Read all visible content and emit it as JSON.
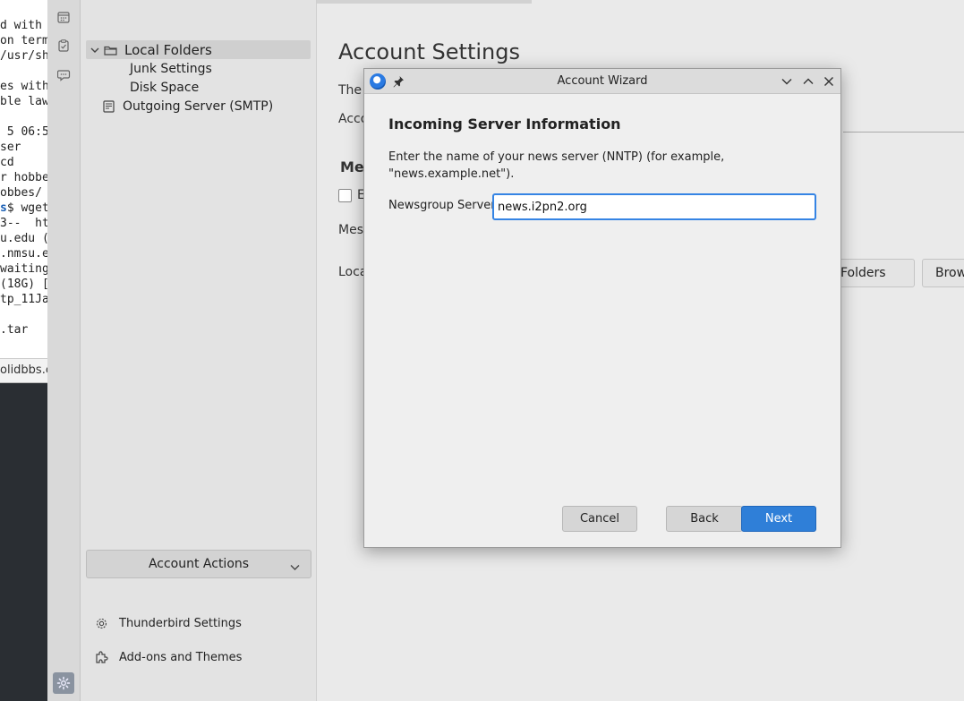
{
  "terminal": {
    "lines": [
      {
        "prefix": "",
        "text": "d with"
      },
      {
        "prefix": "",
        "text": "on term"
      },
      {
        "prefix": "",
        "text": "/usr/sh"
      },
      {
        "prefix": "",
        "text": ""
      },
      {
        "prefix": "",
        "text": "es with"
      },
      {
        "prefix": "",
        "text": "ble law"
      },
      {
        "prefix": "",
        "text": ""
      },
      {
        "prefix": "",
        "text": " 5 06:5"
      },
      {
        "prefix": "",
        "text": "ser"
      },
      {
        "prefix": "",
        "text": "cd"
      },
      {
        "prefix": "",
        "text": "r hobbe"
      },
      {
        "prefix": "",
        "text": "obbes/"
      },
      {
        "prefix": "s",
        "text": "$ wget"
      },
      {
        "prefix": "",
        "text": "3--  ht"
      },
      {
        "prefix": "",
        "text": "u.edu ("
      },
      {
        "prefix": "",
        "text": ".nmsu.e"
      },
      {
        "prefix": "",
        "text": "waiting"
      },
      {
        "prefix": "",
        "text": "(18G) ["
      },
      {
        "prefix": "",
        "text": "tp_11Ja"
      },
      {
        "prefix": "",
        "text": ""
      },
      {
        "prefix": "",
        "text": ".tar"
      }
    ],
    "url_peek": "olidbbs.c"
  },
  "folder_pane": {
    "account_name": "Local Folders",
    "items": [
      "Junk Settings",
      "Disk Space"
    ],
    "outgoing_server": "Outgoing Server (SMTP)",
    "account_actions_label": "Account Actions",
    "thunderbird_settings": "Thunderbird Settings",
    "addons_themes": "Add-ons and Themes"
  },
  "main": {
    "title": "Account Settings",
    "peek_the": "The",
    "peek_acco": "Acco",
    "peek_me": "Me",
    "peek_e": "E",
    "peek_mes": "Mes",
    "peek_loca": "Loca",
    "folders_button": "Folders",
    "browse_button": "Brow"
  },
  "dialog": {
    "title": "Account Wizard",
    "heading": "Incoming Server Information",
    "description": "Enter the name of your news server (NNTP) (for example, \"news.example.net\").",
    "server_label": "Newsgroup Server",
    "server_value": "news.i2pn2.org",
    "cancel_label": "Cancel",
    "back_label": "Back",
    "next_label": "Next"
  },
  "colors": {
    "accent": "#2f7fd8",
    "focus_ring": "#3584e4",
    "terminal_prompt": "#1a5fb4"
  }
}
